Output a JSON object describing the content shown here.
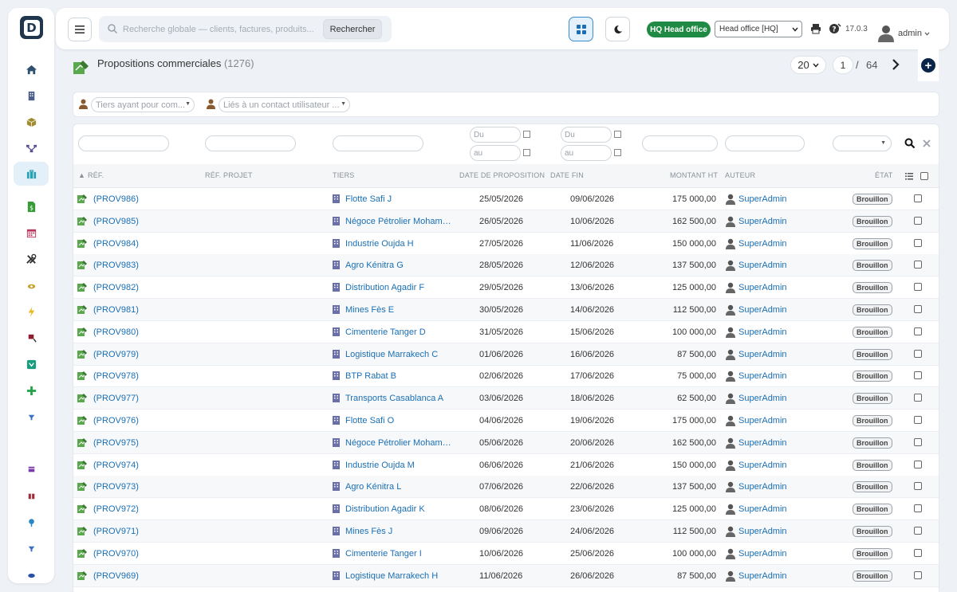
{
  "app": {
    "logo_letter": "D",
    "version": "17.0.3",
    "user": "admin"
  },
  "search": {
    "placeholder": "Recherche globale — clients, factures, produits...",
    "button": "Rechercher"
  },
  "entity": {
    "badge": "HQ Head office",
    "select_value": "Head office [HQ]"
  },
  "page": {
    "title": "Propositions commerciales",
    "count": "(1276)"
  },
  "pager": {
    "limit": "20",
    "page": "1",
    "separator": "/",
    "total": "64"
  },
  "filters": {
    "tiers_placeholder": "Tiers ayant pour com...",
    "contact_placeholder": "Liés à un contact utilisateur ...",
    "date_from": "Du",
    "date_to": "au"
  },
  "columns": {
    "ref": "RÉF.",
    "ref_projet": "RÉF. PROJET",
    "tiers": "TIERS",
    "date_proposition": "DATE DE PROPOSITION",
    "date_fin": "DATE FIN",
    "montant_ht": "MONTANT HT",
    "auteur": "AUTEUR",
    "etat": "ÉTAT"
  },
  "rows": [
    {
      "ref": "(PROV986)",
      "tiers": "Flotte Safi J",
      "date1": "25/05/2026",
      "date2": "09/06/2026",
      "montant": "175 000,00",
      "auteur": "SuperAdmin",
      "etat": "Brouillon"
    },
    {
      "ref": "(PROV985)",
      "tiers": "Négoce Pétrolier Moham…",
      "date1": "26/05/2026",
      "date2": "10/06/2026",
      "montant": "162 500,00",
      "auteur": "SuperAdmin",
      "etat": "Brouillon"
    },
    {
      "ref": "(PROV984)",
      "tiers": "Industrie Oujda H",
      "date1": "27/05/2026",
      "date2": "11/06/2026",
      "montant": "150 000,00",
      "auteur": "SuperAdmin",
      "etat": "Brouillon"
    },
    {
      "ref": "(PROV983)",
      "tiers": "Agro Kénitra G",
      "date1": "28/05/2026",
      "date2": "12/06/2026",
      "montant": "137 500,00",
      "auteur": "SuperAdmin",
      "etat": "Brouillon"
    },
    {
      "ref": "(PROV982)",
      "tiers": "Distribution Agadir F",
      "date1": "29/05/2026",
      "date2": "13/06/2026",
      "montant": "125 000,00",
      "auteur": "SuperAdmin",
      "etat": "Brouillon"
    },
    {
      "ref": "(PROV981)",
      "tiers": "Mines Fès E",
      "date1": "30/05/2026",
      "date2": "14/06/2026",
      "montant": "112 500,00",
      "auteur": "SuperAdmin",
      "etat": "Brouillon"
    },
    {
      "ref": "(PROV980)",
      "tiers": "Cimenterie Tanger D",
      "date1": "31/05/2026",
      "date2": "15/06/2026",
      "montant": "100 000,00",
      "auteur": "SuperAdmin",
      "etat": "Brouillon"
    },
    {
      "ref": "(PROV979)",
      "tiers": "Logistique Marrakech C",
      "date1": "01/06/2026",
      "date2": "16/06/2026",
      "montant": "87 500,00",
      "auteur": "SuperAdmin",
      "etat": "Brouillon"
    },
    {
      "ref": "(PROV978)",
      "tiers": "BTP Rabat B",
      "date1": "02/06/2026",
      "date2": "17/06/2026",
      "montant": "75 000,00",
      "auteur": "SuperAdmin",
      "etat": "Brouillon"
    },
    {
      "ref": "(PROV977)",
      "tiers": "Transports Casablanca A",
      "date1": "03/06/2026",
      "date2": "18/06/2026",
      "montant": "62 500,00",
      "auteur": "SuperAdmin",
      "etat": "Brouillon"
    },
    {
      "ref": "(PROV976)",
      "tiers": "Flotte Safi O",
      "date1": "04/06/2026",
      "date2": "19/06/2026",
      "montant": "175 000,00",
      "auteur": "SuperAdmin",
      "etat": "Brouillon"
    },
    {
      "ref": "(PROV975)",
      "tiers": "Négoce Pétrolier Moham…",
      "date1": "05/06/2026",
      "date2": "20/06/2026",
      "montant": "162 500,00",
      "auteur": "SuperAdmin",
      "etat": "Brouillon"
    },
    {
      "ref": "(PROV974)",
      "tiers": "Industrie Oujda M",
      "date1": "06/06/2026",
      "date2": "21/06/2026",
      "montant": "150 000,00",
      "auteur": "SuperAdmin",
      "etat": "Brouillon"
    },
    {
      "ref": "(PROV973)",
      "tiers": "Agro Kénitra L",
      "date1": "07/06/2026",
      "date2": "22/06/2026",
      "montant": "137 500,00",
      "auteur": "SuperAdmin",
      "etat": "Brouillon"
    },
    {
      "ref": "(PROV972)",
      "tiers": "Distribution Agadir K",
      "date1": "08/06/2026",
      "date2": "23/06/2026",
      "montant": "125 000,00",
      "auteur": "SuperAdmin",
      "etat": "Brouillon"
    },
    {
      "ref": "(PROV971)",
      "tiers": "Mines Fès J",
      "date1": "09/06/2026",
      "date2": "24/06/2026",
      "montant": "112 500,00",
      "auteur": "SuperAdmin",
      "etat": "Brouillon"
    },
    {
      "ref": "(PROV970)",
      "tiers": "Cimenterie Tanger I",
      "date1": "10/06/2026",
      "date2": "25/06/2026",
      "montant": "100 000,00",
      "auteur": "SuperAdmin",
      "etat": "Brouillon"
    },
    {
      "ref": "(PROV969)",
      "tiers": "Logistique Marrakech H",
      "date1": "11/06/2026",
      "date2": "26/06/2026",
      "montant": "87 500,00",
      "auteur": "SuperAdmin",
      "etat": "Brouillon"
    }
  ],
  "sidebar": [
    {
      "icon": "home-icon",
      "color": "#2e4f6d"
    },
    {
      "icon": "building-icon",
      "color": "#4d5f8a"
    },
    {
      "icon": "product-box-icon",
      "color": "#a08c2e"
    },
    {
      "icon": "project-tree-icon",
      "color": "#5b4f8f"
    },
    {
      "icon": "briefcase-icon",
      "color": "#28a1b3"
    },
    {
      "icon": "invoice-dollar-icon",
      "color": "#3a9b3a"
    },
    {
      "icon": "calendar-icon",
      "color": "#b4375e"
    },
    {
      "icon": "tools-icon",
      "color": "#333333"
    },
    {
      "icon": "eye-icon",
      "color": "#c7a32c"
    },
    {
      "icon": "bolt-icon",
      "color": "#e8b81f"
    },
    {
      "icon": "flag-icon",
      "color": "#8c2030"
    },
    {
      "icon": "shield-icon",
      "color": "#1a9c80"
    },
    {
      "icon": "plus-icon",
      "color": "#22a34a"
    },
    {
      "icon": "filter-icon",
      "color": "#3a6fc4"
    },
    {
      "icon": "calendar-small-icon",
      "color": "#7a3aa8"
    },
    {
      "icon": "gift-icon",
      "color": "#a32a3a"
    },
    {
      "icon": "pin-icon",
      "color": "#2a86c4"
    },
    {
      "icon": "filter-small-icon",
      "color": "#3a6fc4"
    },
    {
      "icon": "cloud-icon",
      "color": "#2a4fa8"
    }
  ],
  "colors": {
    "link": "#1a6fb4",
    "hq_green": "#1f8a43",
    "add_navy": "#0b2548"
  }
}
